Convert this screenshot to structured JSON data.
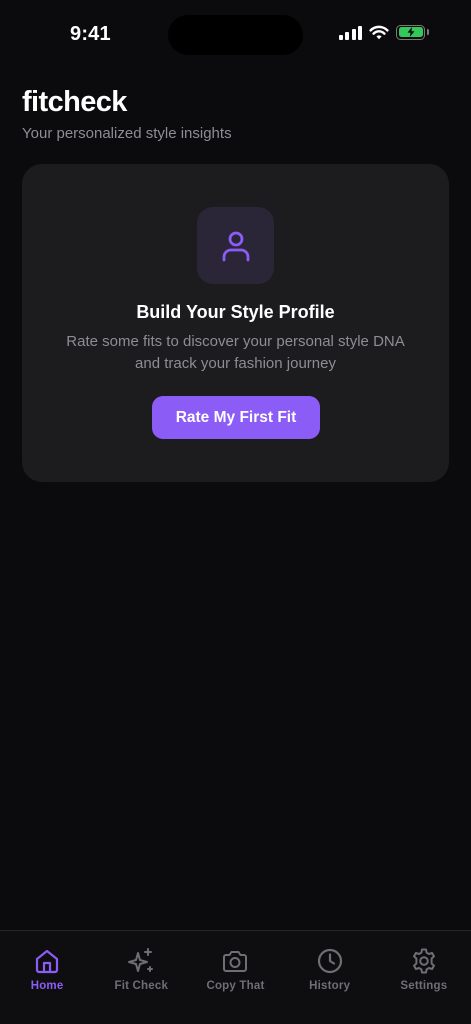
{
  "status_bar": {
    "time": "9:41"
  },
  "header": {
    "title": "fitcheck",
    "subtitle": "Your personalized style insights"
  },
  "profile_card": {
    "icon": "person-icon",
    "title": "Build Your Style Profile",
    "description": "Rate some fits to discover your personal style DNA and track your fashion journey",
    "cta_label": "Rate My First Fit"
  },
  "tabs": [
    {
      "label": "Home",
      "icon": "home-icon",
      "active": true
    },
    {
      "label": "Fit Check",
      "icon": "sparkles-icon",
      "active": false
    },
    {
      "label": "Copy That",
      "icon": "camera-icon",
      "active": false
    },
    {
      "label": "History",
      "icon": "clock-icon",
      "active": false
    },
    {
      "label": "Settings",
      "icon": "gear-icon",
      "active": false
    }
  ],
  "colors": {
    "background": "#0b0b0d",
    "card": "#1c1c1e",
    "accent": "#8b5cf6",
    "muted_text": "#8d8d93",
    "inactive_tab": "#6e6e73",
    "battery": "#34c759"
  }
}
